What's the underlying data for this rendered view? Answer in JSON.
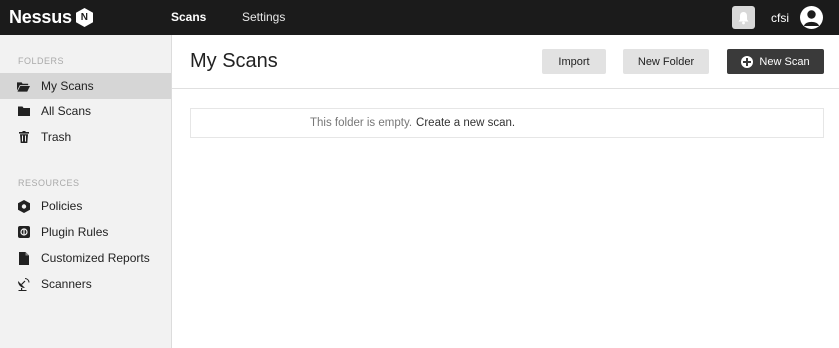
{
  "app": {
    "logo_text": "Nessus",
    "logo_badge": "N"
  },
  "topnav": {
    "items": [
      {
        "label": "Scans"
      },
      {
        "label": "Settings"
      }
    ],
    "user_name": "cfsi"
  },
  "sidebar": {
    "folders_title": "FOLDERS",
    "folders": [
      {
        "label": "My Scans",
        "icon": "folder-open-icon",
        "active": true
      },
      {
        "label": "All Scans",
        "icon": "folder-icon"
      },
      {
        "label": "Trash",
        "icon": "trash-icon"
      }
    ],
    "resources_title": "RESOURCES",
    "resources": [
      {
        "label": "Policies",
        "icon": "policy-icon"
      },
      {
        "label": "Plugin Rules",
        "icon": "plugin-rules-icon"
      },
      {
        "label": "Customized Reports",
        "icon": "report-icon"
      },
      {
        "label": "Scanners",
        "icon": "satellite-dish-icon"
      }
    ]
  },
  "main": {
    "title": "My Scans",
    "buttons": {
      "import": "Import",
      "new_folder": "New Folder",
      "new_scan": "New Scan"
    },
    "empty_message": "This folder is empty.",
    "empty_link": "Create a new scan."
  },
  "colors": {
    "topbar": "#1b1b1b",
    "sidebar": "#f2f2f2",
    "active_item": "#d6d6d6",
    "primary_button": "#3a3a3a"
  }
}
